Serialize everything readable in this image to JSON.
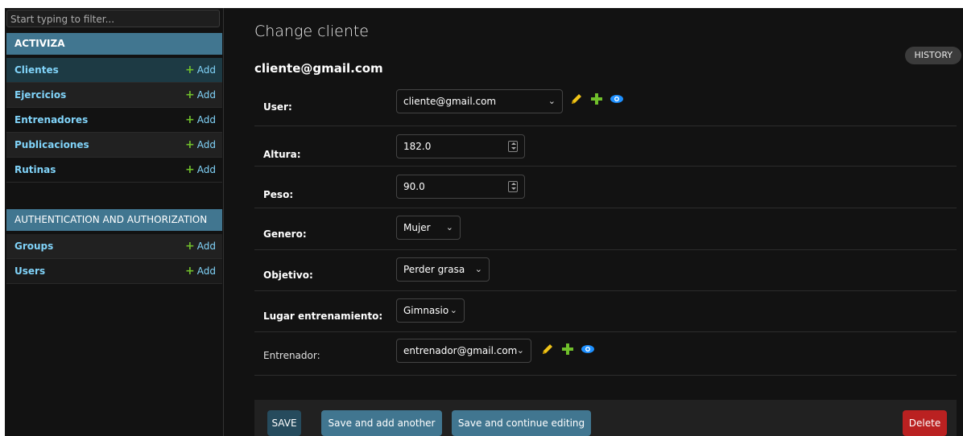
{
  "sidebar": {
    "filter_placeholder": "Start typing to filter...",
    "modules": [
      {
        "name": "ACTIVIZA",
        "models": [
          {
            "label": "Clientes",
            "add": "Add"
          },
          {
            "label": "Ejercicios",
            "add": "Add"
          },
          {
            "label": "Entrenadores",
            "add": "Add"
          },
          {
            "label": "Publicaciones",
            "add": "Add"
          },
          {
            "label": "Rutinas",
            "add": "Add"
          }
        ]
      },
      {
        "name": "AUTHENTICATION AND AUTHORIZATION",
        "models": [
          {
            "label": "Groups",
            "add": "Add"
          },
          {
            "label": "Users",
            "add": "Add"
          }
        ]
      }
    ]
  },
  "main": {
    "title": "Change cliente",
    "object_title": "cliente@gmail.com",
    "history": "HISTORY",
    "fields": {
      "user": {
        "label": "User:",
        "value": "cliente@gmail.com"
      },
      "altura": {
        "label": "Altura:",
        "value": "182.0"
      },
      "peso": {
        "label": "Peso:",
        "value": "90.0"
      },
      "genero": {
        "label": "Genero:",
        "value": "Mujer"
      },
      "objetivo": {
        "label": "Objetivo:",
        "value": "Perder grasa"
      },
      "lugar": {
        "label": "Lugar entrenamiento:",
        "value": "Gimnasio"
      },
      "entrenador": {
        "label": "Entrenador:",
        "value": "entrenador@gmail.com"
      }
    },
    "buttons": {
      "save": "SAVE",
      "save_add": "Save and add another",
      "save_continue": "Save and continue editing",
      "delete": "Delete"
    }
  },
  "colors": {
    "accent": "#417690",
    "link": "#81d4fa",
    "add_green": "#70bf2b",
    "delete_red": "#ba2121",
    "pencil_yellow": "#f0c419",
    "eye_blue": "#1e90ff"
  }
}
